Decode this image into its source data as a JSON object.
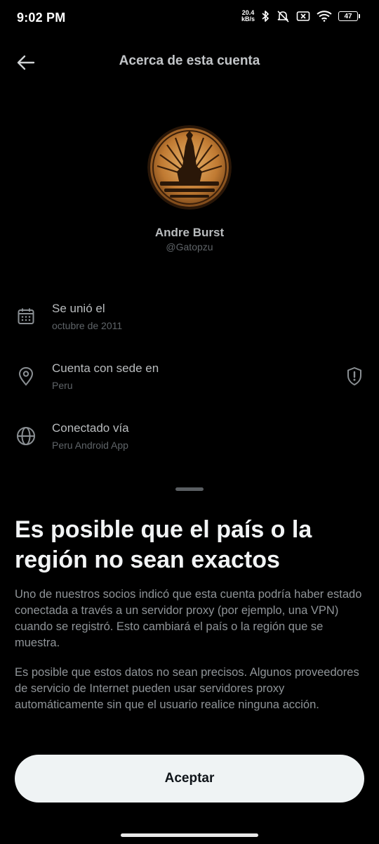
{
  "status_bar": {
    "time": "9:02 PM",
    "net_speed_value": "20.4",
    "net_speed_unit": "kB/s",
    "battery": "47",
    "icons": [
      "bluetooth-icon",
      "mute-icon",
      "sim-off-icon",
      "wifi-icon",
      "battery-icon"
    ]
  },
  "header": {
    "title": "Acerca de esta cuenta",
    "back_icon": "arrow-left-icon"
  },
  "profile": {
    "name": "Andre Burst",
    "handle": "@Gatopzu"
  },
  "info_rows": [
    {
      "icon": "calendar-icon",
      "title": "Se unió el",
      "value": "octubre de 2011"
    },
    {
      "icon": "location-pin-icon",
      "title": "Cuenta con sede en",
      "value": "Peru",
      "trailing_icon": "shield-alert-icon"
    },
    {
      "icon": "globe-icon",
      "title": "Conectado vía",
      "value": "Peru Android App"
    }
  ],
  "sheet": {
    "title": "Es posible que el país o la región no sean exactos",
    "paragraph_1": "Uno de nuestros socios indicó que esta cuenta podría haber estado conectada a través a un servidor proxy (por ejemplo, una VPN) cuando se registró. Esto cambiará el país o la región que se muestra.",
    "paragraph_2": "Es posible que estos datos no sean precisos. Algunos proveedores de servicio de Internet pueden usar servidores proxy automáticamente sin que el usuario realice ninguna acción.",
    "accept_label": "Aceptar"
  },
  "colors": {
    "background": "#000000",
    "button_bg": "#eff3f4",
    "muted_text": "#5f6468",
    "avatar_gold": "#c8873a"
  }
}
